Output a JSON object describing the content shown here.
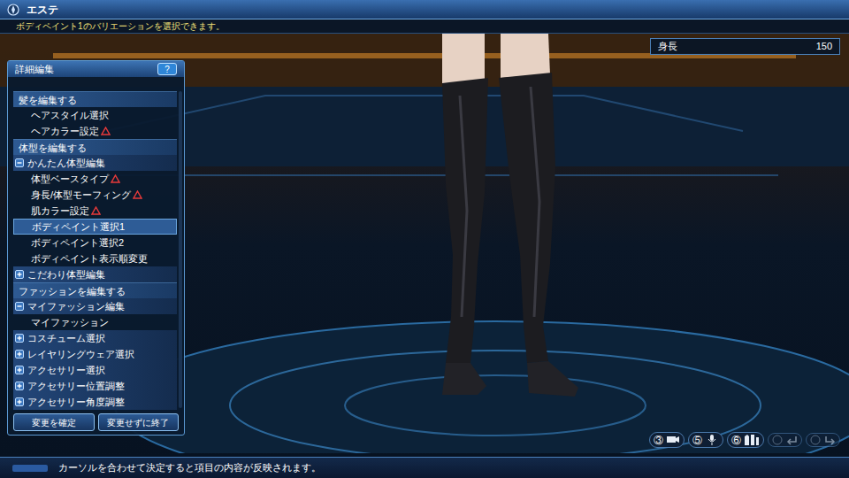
{
  "window": {
    "title": "エステ"
  },
  "hint": "ボディペイント1のバリエーションを選択できます。",
  "height": {
    "label": "身長",
    "value": "150"
  },
  "panel": {
    "title": "詳細編集",
    "help": "?",
    "items": [
      {
        "kind": "section",
        "label": "髪を編集する",
        "selected": false,
        "warning": false
      },
      {
        "kind": "item",
        "label": "ヘアスタイル選択",
        "selected": false,
        "warning": false
      },
      {
        "kind": "item",
        "label": "ヘアカラー設定",
        "selected": false,
        "warning": true
      },
      {
        "kind": "section",
        "label": "体型を編集する",
        "selected": false,
        "warning": false
      },
      {
        "kind": "group",
        "label": "かんたん体型編集",
        "selected": false,
        "warning": false,
        "expanded": true
      },
      {
        "kind": "item",
        "label": "体型ベースタイプ",
        "selected": false,
        "warning": true
      },
      {
        "kind": "item",
        "label": "身長/体型モーフィング",
        "selected": false,
        "warning": true
      },
      {
        "kind": "item",
        "label": "肌カラー設定",
        "selected": false,
        "warning": true
      },
      {
        "kind": "item",
        "label": "ボディペイント選択1",
        "selected": true,
        "warning": false
      },
      {
        "kind": "item",
        "label": "ボディペイント選択2",
        "selected": false,
        "warning": false
      },
      {
        "kind": "item",
        "label": "ボディペイント表示順変更",
        "selected": false,
        "warning": false
      },
      {
        "kind": "group",
        "label": "こだわり体型編集",
        "selected": false,
        "warning": false,
        "expanded": false
      },
      {
        "kind": "section",
        "label": "ファッションを編集する",
        "selected": false,
        "warning": false
      },
      {
        "kind": "group",
        "label": "マイファッション編集",
        "selected": false,
        "warning": false,
        "expanded": true
      },
      {
        "kind": "item",
        "label": "マイファッション",
        "selected": false,
        "warning": false
      },
      {
        "kind": "group",
        "label": "コスチューム選択",
        "selected": false,
        "warning": false,
        "expanded": false
      },
      {
        "kind": "group",
        "label": "レイヤリングウェア選択",
        "selected": false,
        "warning": false,
        "expanded": false
      },
      {
        "kind": "group",
        "label": "アクセサリー選択",
        "selected": false,
        "warning": false,
        "expanded": false
      },
      {
        "kind": "group",
        "label": "アクセサリー位置調整",
        "selected": false,
        "warning": false,
        "expanded": false
      },
      {
        "kind": "group",
        "label": "アクセサリー角度調整",
        "selected": false,
        "warning": false,
        "expanded": false
      }
    ]
  },
  "buttons": [
    "変更を確定",
    "変更せずに終了"
  ],
  "controls": [
    {
      "kind": "camera",
      "key": "③"
    },
    {
      "kind": "voice",
      "key": "⑤"
    },
    {
      "kind": "wear",
      "key": "⑥"
    }
  ],
  "nav": [
    {
      "kind": "back",
      "disabled": true
    },
    {
      "kind": "forward",
      "disabled": true
    }
  ],
  "status": "カーソルを合わせて決定すると項目の内容が反映されます。"
}
